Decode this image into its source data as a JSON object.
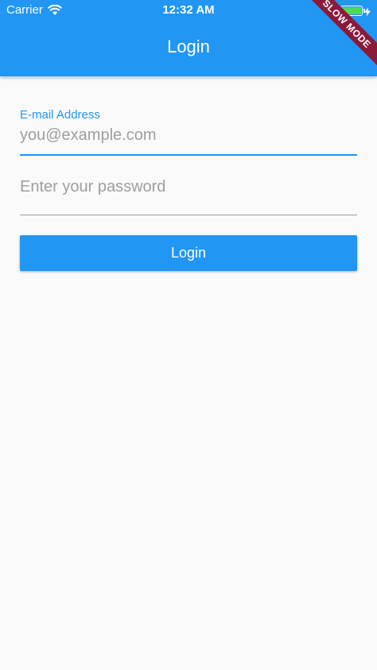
{
  "status_bar": {
    "carrier": "Carrier",
    "time": "12:32 AM",
    "wifi_icon": "wifi-icon",
    "battery_icon": "battery-icon",
    "charging_icon": "bolt-icon"
  },
  "app_bar": {
    "title": "Login",
    "background_color": "#2196f3"
  },
  "debug_banner": {
    "label": "SLOW MODE"
  },
  "form": {
    "email": {
      "label": "E-mail Address",
      "value": "",
      "placeholder": "you@example.com"
    },
    "password": {
      "value": "",
      "placeholder": "Enter your password"
    },
    "submit_label": "Login"
  },
  "colors": {
    "accent": "#2196f3",
    "background": "#fafafa",
    "banner": "#8b1a3a"
  }
}
